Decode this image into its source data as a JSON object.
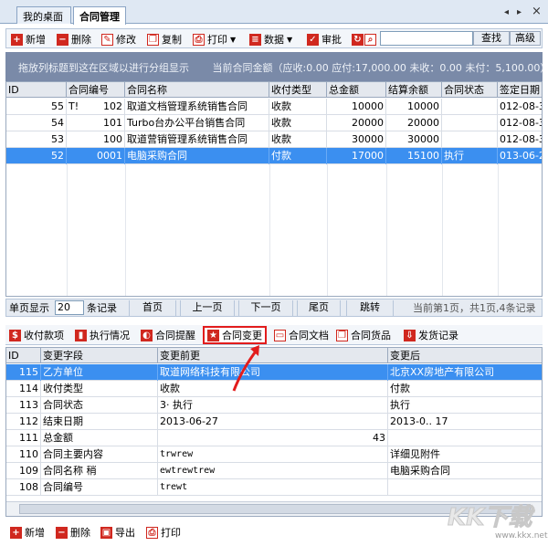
{
  "tabs": [
    {
      "label": "我的桌面"
    },
    {
      "label": "合同管理"
    }
  ],
  "window_controls": {
    "prev": "◂",
    "next": "▸",
    "close": "×"
  },
  "toolbar": {
    "add": "新增",
    "delete": "删除",
    "edit": "修改",
    "copy": "复制",
    "print": "打印",
    "data": "数据",
    "approve": "审批",
    "search_value": "",
    "find": "查找",
    "advanced": "高级"
  },
  "group_panel": {
    "hint": "拖放列标题到这在区域以进行分组显示",
    "summary": "当前合同金额（应收:0.00  应付:17,000.00  未收：0.00  未付：5,100.00）"
  },
  "contracts": {
    "columns": [
      "ID",
      "合同编号",
      "合同名称",
      "收付类型",
      "总金额",
      "结算余额",
      "合同状态",
      "签定日期"
    ],
    "rows": [
      {
        "id": "55",
        "prefix": "T!",
        "no": "102",
        "name": "取道文档管理系统销售合同",
        "type": "收款",
        "total": "10000",
        "balance": "10000",
        "status": "",
        "date": "012-08-3"
      },
      {
        "id": "54",
        "prefix": "",
        "no": "101",
        "name": "Turbo台办公平台销售合同",
        "type": "收款",
        "total": "20000",
        "balance": "20000",
        "status": "",
        "date": "012-08-3"
      },
      {
        "id": "53",
        "prefix": "",
        "no": "100",
        "name": "取道营销管理系统销售合同",
        "type": "收款",
        "total": "30000",
        "balance": "30000",
        "status": "",
        "date": "012-08-3"
      },
      {
        "id": "52",
        "prefix": "",
        "no": "0001",
        "name": "电脑采购合同",
        "type": "付款",
        "total": "17000",
        "balance": "15100",
        "status": "执行",
        "date": "013-06-2"
      }
    ]
  },
  "pager": {
    "page_size_label": "单页显示",
    "page_size": "20",
    "records_label": "条记录",
    "first": "首页",
    "prev": "上一页",
    "next": "下一页",
    "last": "尾页",
    "jump": "跳转",
    "status": "当前第1页，共1页,4条记录"
  },
  "detail_tabs": [
    {
      "label": "收付款项",
      "icon": "dollar-icon"
    },
    {
      "label": "执行情况",
      "icon": "progress-icon"
    },
    {
      "label": "合同提醒",
      "icon": "bell-icon"
    },
    {
      "label": "合同变更",
      "icon": "star-icon"
    },
    {
      "label": "合同文档",
      "icon": "folder-icon"
    },
    {
      "label": "合同货品",
      "icon": "goods-icon"
    },
    {
      "label": "发货记录",
      "icon": "shipping-icon"
    }
  ],
  "changes": {
    "columns": [
      "ID",
      "变更字段",
      "变更前更",
      "变更后"
    ],
    "rows": [
      {
        "id": "115",
        "field": "乙方单位",
        "before": "取道网络科技有限公司",
        "after": "北京XX房地产有限公司"
      },
      {
        "id": "114",
        "field": "收付类型",
        "before": "收款",
        "after": "付款"
      },
      {
        "id": "113",
        "field": "合同状态",
        "before": "3· 执行",
        "after": "执行"
      },
      {
        "id": "112",
        "field": "结束日期",
        "before": "2013-06-27",
        "after": "2013-0.. 17"
      },
      {
        "id": "111",
        "field": "总金额",
        "before": "43",
        "after": ""
      },
      {
        "id": "110",
        "field": "合同主要内容",
        "before": "trwrew",
        "after": "详细见附件"
      },
      {
        "id": "109",
        "field": "合同名称 稍",
        "before": "ewtrewtrew",
        "after": "电脑采购合同"
      },
      {
        "id": "108",
        "field": "合同编号",
        "before": "trewt",
        "after": ""
      }
    ]
  },
  "bottom_toolbar": {
    "add": "新增",
    "delete": "删除",
    "export": "导出",
    "print": "打印"
  },
  "watermark": {
    "text": "KK下载",
    "url": "www.kkx.net"
  },
  "colors": {
    "selection": "#3b8ff0",
    "accent_red": "#d0281f",
    "group_panel": "#7a8aa8",
    "highlight_border": "#e21c1c"
  }
}
